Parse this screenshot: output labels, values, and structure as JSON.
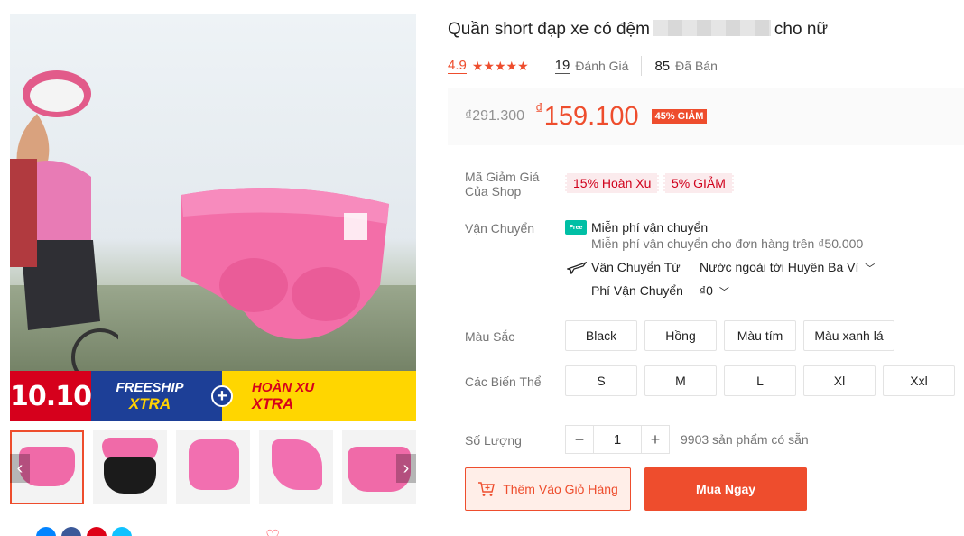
{
  "gallery": {
    "promo": {
      "badge": "10.10",
      "freeship": "FREESHIP",
      "freeship_x": "XTRA",
      "plus": "+",
      "hoanxu": "HOÀN XU",
      "hoanxu_x": "XTRA"
    },
    "thumb_count": 5,
    "nav_left": "‹",
    "nav_right": "›"
  },
  "product": {
    "title_prefix": "Quần short đạp xe có đệm",
    "title_suffix": "cho nữ",
    "rating": "4.9",
    "stars": "★★★★★",
    "reviews_count": "19",
    "reviews_label": "Đánh Giá",
    "sold_count": "85",
    "sold_label": "Đã Bán"
  },
  "price": {
    "original": "₫291.300",
    "currency": "₫",
    "current": "159.100",
    "discount": "45% GIẢM"
  },
  "voucher": {
    "label_line1": "Mã Giảm Giá",
    "label_line2": "Của Shop",
    "tags": [
      "15% Hoàn Xu",
      "5% GIẢM"
    ]
  },
  "shipping": {
    "label": "Vận Chuyển",
    "free_icon_text": "Free",
    "free_title": "Miễn phí vận chuyển",
    "free_desc": "Miễn phí vận chuyển cho đơn hàng trên ₫50.000",
    "from_label": "Vận Chuyển Từ",
    "from_value": "Nước ngoài tới Huyện Ba Vì",
    "fee_label": "Phí Vận Chuyển",
    "fee_value": "₫0"
  },
  "colors": {
    "label": "Màu Sắc",
    "options": [
      "Black",
      "Hồng",
      "Màu tím",
      "Màu xanh lá"
    ]
  },
  "variants": {
    "label": "Các Biến Thể",
    "options": [
      "S",
      "M",
      "L",
      "Xl",
      "Xxl"
    ]
  },
  "quantity": {
    "label": "Số Lượng",
    "minus": "−",
    "value": "1",
    "plus": "+",
    "stock": "9903 sản phẩm có sẵn"
  },
  "actions": {
    "add_to_cart": "Thêm Vào Giỏ Hàng",
    "buy_now": "Mua Ngay"
  },
  "theme": {
    "accent": "#ee4d2d"
  }
}
